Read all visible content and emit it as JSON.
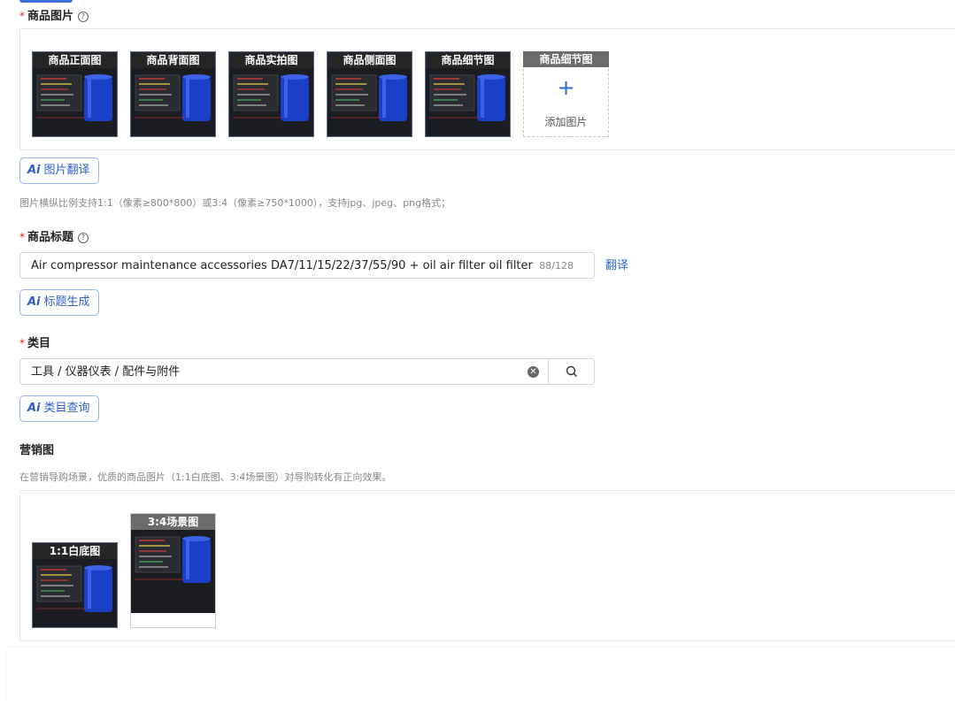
{
  "product_images": {
    "label": "商品图片",
    "images": [
      {
        "caption": "商品正面图"
      },
      {
        "caption": "商品背面图"
      },
      {
        "caption": "商品实拍图"
      },
      {
        "caption": "商品侧面图"
      },
      {
        "caption": "商品细节图"
      }
    ],
    "add_tile": {
      "caption": "商品细节图",
      "label": "添加图片"
    },
    "ai_button": "图片翻译",
    "hint": "图片横纵比例支持1:1（像素≥800*800）或3:4（像素≥750*1000），支持jpg、jpeg、png格式；"
  },
  "product_title": {
    "label": "商品标题",
    "value": "Air compressor maintenance accessories DA7/11/15/22/37/55/90 + oil air filter oil filter",
    "counter": "88/128",
    "translate_link": "翻译",
    "ai_button": "标题生成"
  },
  "category": {
    "label": "类目",
    "value": "工具 / 仪器仪表 / 配件与附件",
    "ai_button": "类目查询"
  },
  "marketing": {
    "label": "营销图",
    "hint": "在营销导购场景，优质的商品图片（1:1白底图、3:4场景图）对导购转化有正向效果。",
    "images": [
      {
        "caption": "1:1白底图"
      },
      {
        "caption": "3:4场景图"
      }
    ]
  },
  "colors": {
    "accent": "#2f66d0",
    "required": "#e02020",
    "product_blue": "#1a3fc8"
  }
}
